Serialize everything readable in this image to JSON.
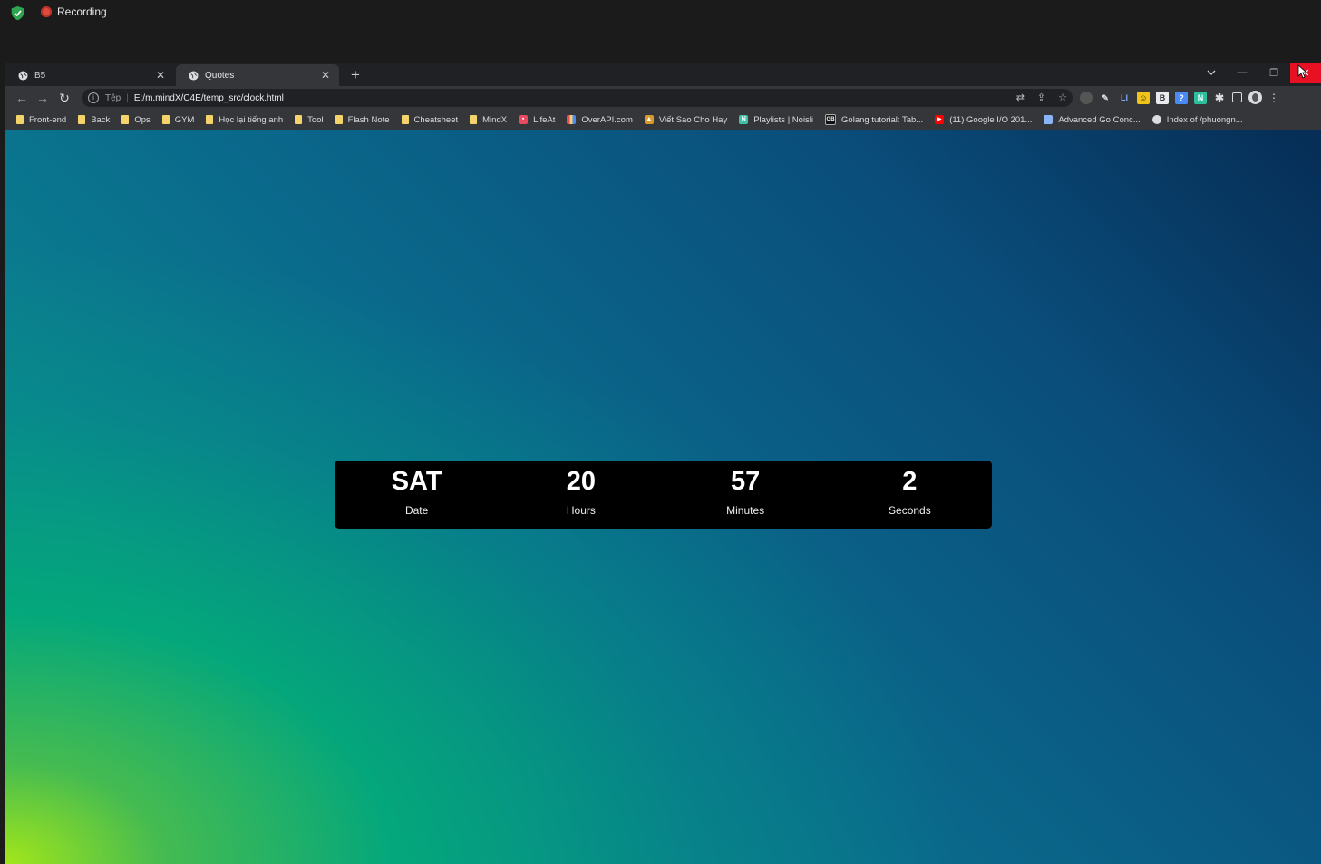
{
  "recorder": {
    "label": "Recording"
  },
  "tabs": [
    {
      "title": "B5",
      "active": false
    },
    {
      "title": "Quotes",
      "active": true
    }
  ],
  "omnibox": {
    "scheme_label": "Tệp",
    "url": "E:/m.mindX/C4E/temp_src/clock.html"
  },
  "bookmarks": [
    {
      "label": "Front-end",
      "icon": "folder"
    },
    {
      "label": "Back",
      "icon": "folder"
    },
    {
      "label": "Ops",
      "icon": "folder"
    },
    {
      "label": "GYM",
      "icon": "folder"
    },
    {
      "label": "Học lại tiếng anh",
      "icon": "folder"
    },
    {
      "label": "Tool",
      "icon": "folder"
    },
    {
      "label": "Flash Note",
      "icon": "folder"
    },
    {
      "label": "Cheatsheet",
      "icon": "folder"
    },
    {
      "label": "MindX",
      "icon": "folder"
    },
    {
      "label": "LifeAt",
      "icon": "lifeat",
      "color": "#e84a5f"
    },
    {
      "label": "OverAPI.com",
      "icon": "overapi",
      "color": "#7b5cd6"
    },
    {
      "label": "Viết Sao Cho Hay",
      "icon": "vietsao",
      "color": "#d99a2b"
    },
    {
      "label": "Playlists | Noisli",
      "icon": "noisli",
      "color": "#3fc1a6"
    },
    {
      "label": "Golang tutorial: Tab...",
      "icon": "gb",
      "color": "#111111"
    },
    {
      "label": "(11) Google I/O 201...",
      "icon": "youtube",
      "color": "#ff0000"
    },
    {
      "label": "Advanced Go Conc...",
      "icon": "doc",
      "color": "#8ab4f8"
    },
    {
      "label": "Index of /phuongn...",
      "icon": "globe",
      "color": "#dadce0"
    }
  ],
  "clock": {
    "date": {
      "value": "SAT",
      "label": "Date"
    },
    "hours": {
      "value": "20",
      "label": "Hours"
    },
    "minutes": {
      "value": "57",
      "label": "Minutes"
    },
    "seconds": {
      "value": "2",
      "label": "Seconds"
    }
  }
}
